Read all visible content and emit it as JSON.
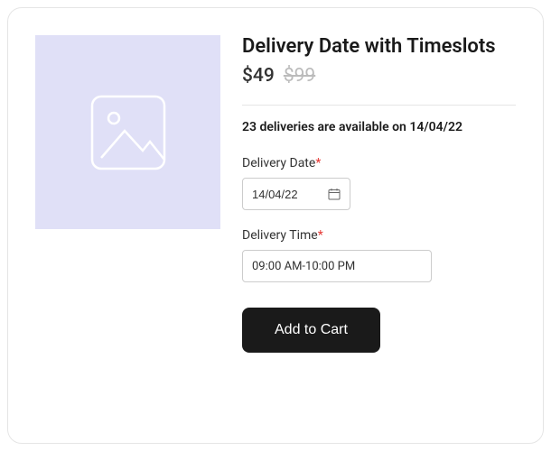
{
  "product": {
    "title": "Delivery Date with Timeslots",
    "price": "$49",
    "original_price": "$99"
  },
  "availability": "23 deliveries are available on 14/04/22",
  "form": {
    "date_label": "Delivery Date",
    "date_value": "14/04/22",
    "time_label": "Delivery Time",
    "time_value": "09:00 AM-10:00 PM"
  },
  "actions": {
    "add_to_cart": "Add to Cart"
  }
}
